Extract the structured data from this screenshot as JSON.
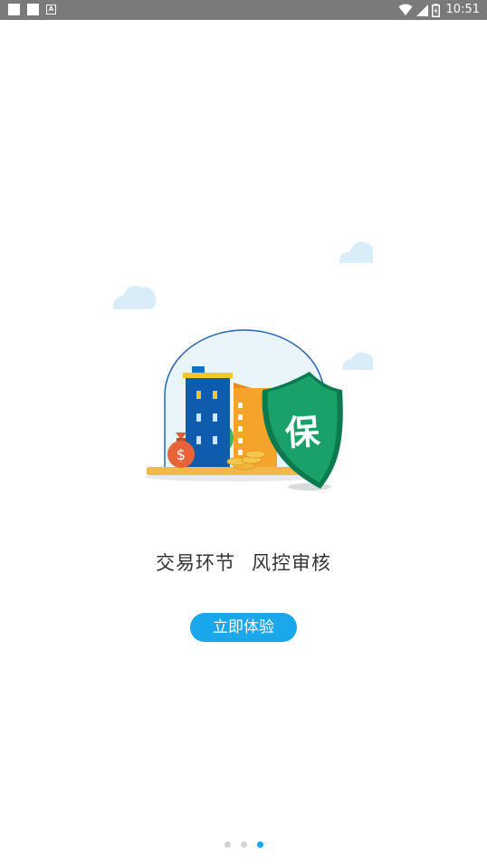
{
  "status_bar": {
    "time": "10:51",
    "left_icons": [
      "notification-square-icon",
      "notification-square-icon",
      "app-a-icon"
    ],
    "right_icons": [
      "wifi-icon",
      "signal-icon",
      "battery-icon"
    ],
    "background_color": "#7a7a7a"
  },
  "onboarding": {
    "page_index": 3,
    "page_count": 3,
    "slogan_part1": "交易环节",
    "slogan_part2": "风控审核",
    "shield_label": "保",
    "start_button_label": "立即体验",
    "accent_color": "#1aa7ec",
    "shield_color": "#1aa169"
  }
}
